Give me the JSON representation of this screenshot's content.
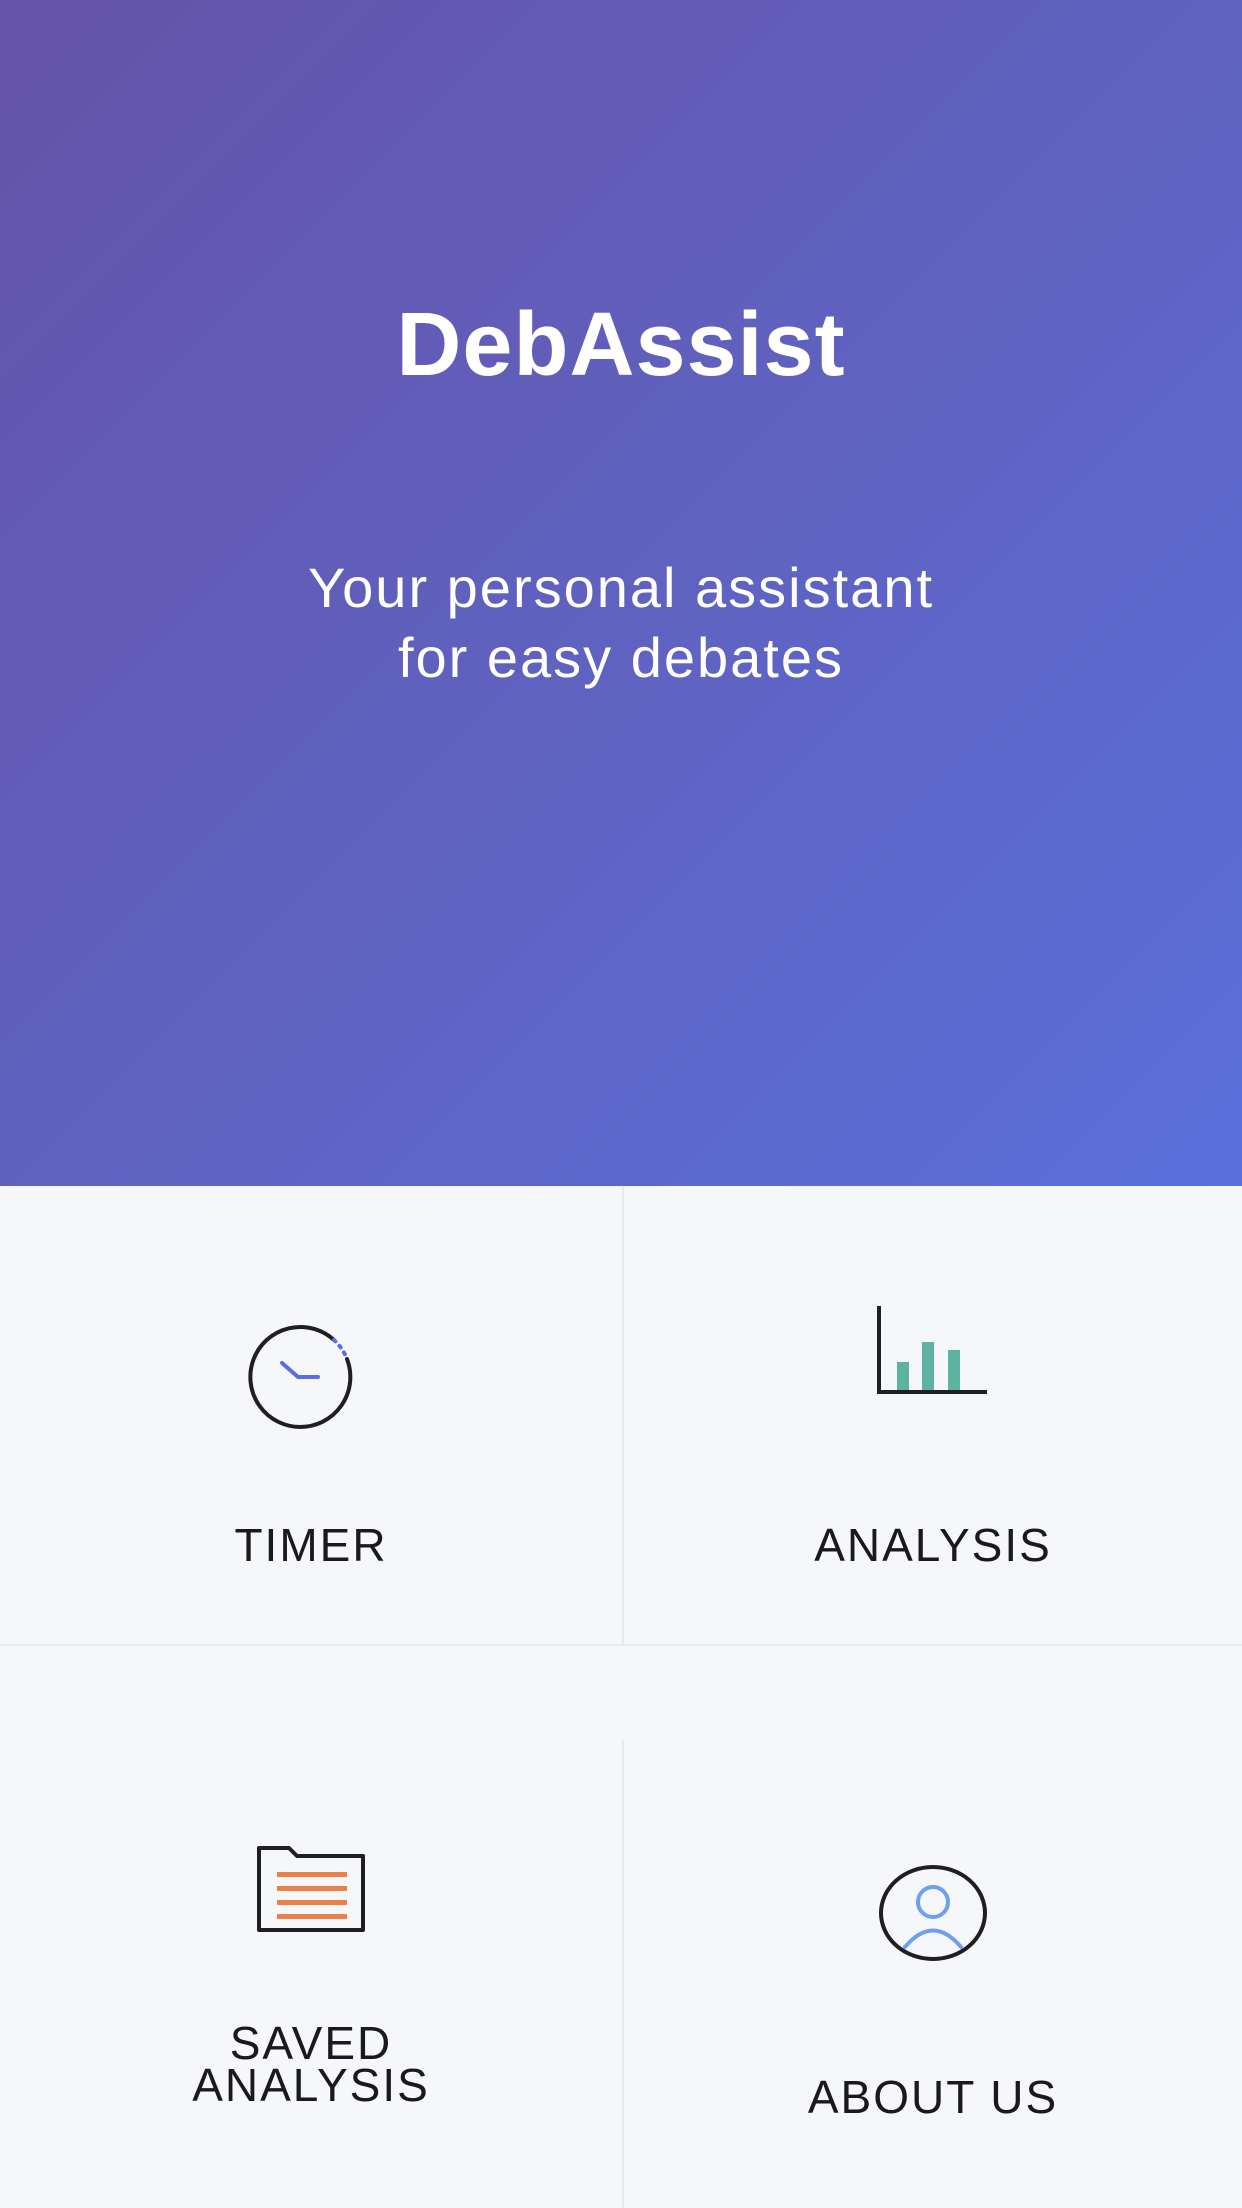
{
  "app": {
    "title": "DebAssist",
    "tagline": "Your personal assistant\nfor easy debates"
  },
  "menu": {
    "timer": {
      "label": "TIMER",
      "icon": "timer-icon"
    },
    "analysis": {
      "label": "ANALYSIS",
      "icon": "bar-chart-icon"
    },
    "saved_analysis": {
      "label": "SAVED\nANALYSIS",
      "icon": "folder-document-icon"
    },
    "about_us": {
      "label": "ABOUT US",
      "icon": "user-profile-icon"
    }
  },
  "colors": {
    "hero_gradient_start": "#6553a9",
    "hero_gradient_end": "#5a6fdb",
    "tile_background": "#f6f7fb",
    "icon_blue": "#5b6ee1",
    "icon_teal": "#5bb3a0",
    "icon_orange": "#e8824a",
    "icon_light_blue": "#6fa0f0"
  }
}
